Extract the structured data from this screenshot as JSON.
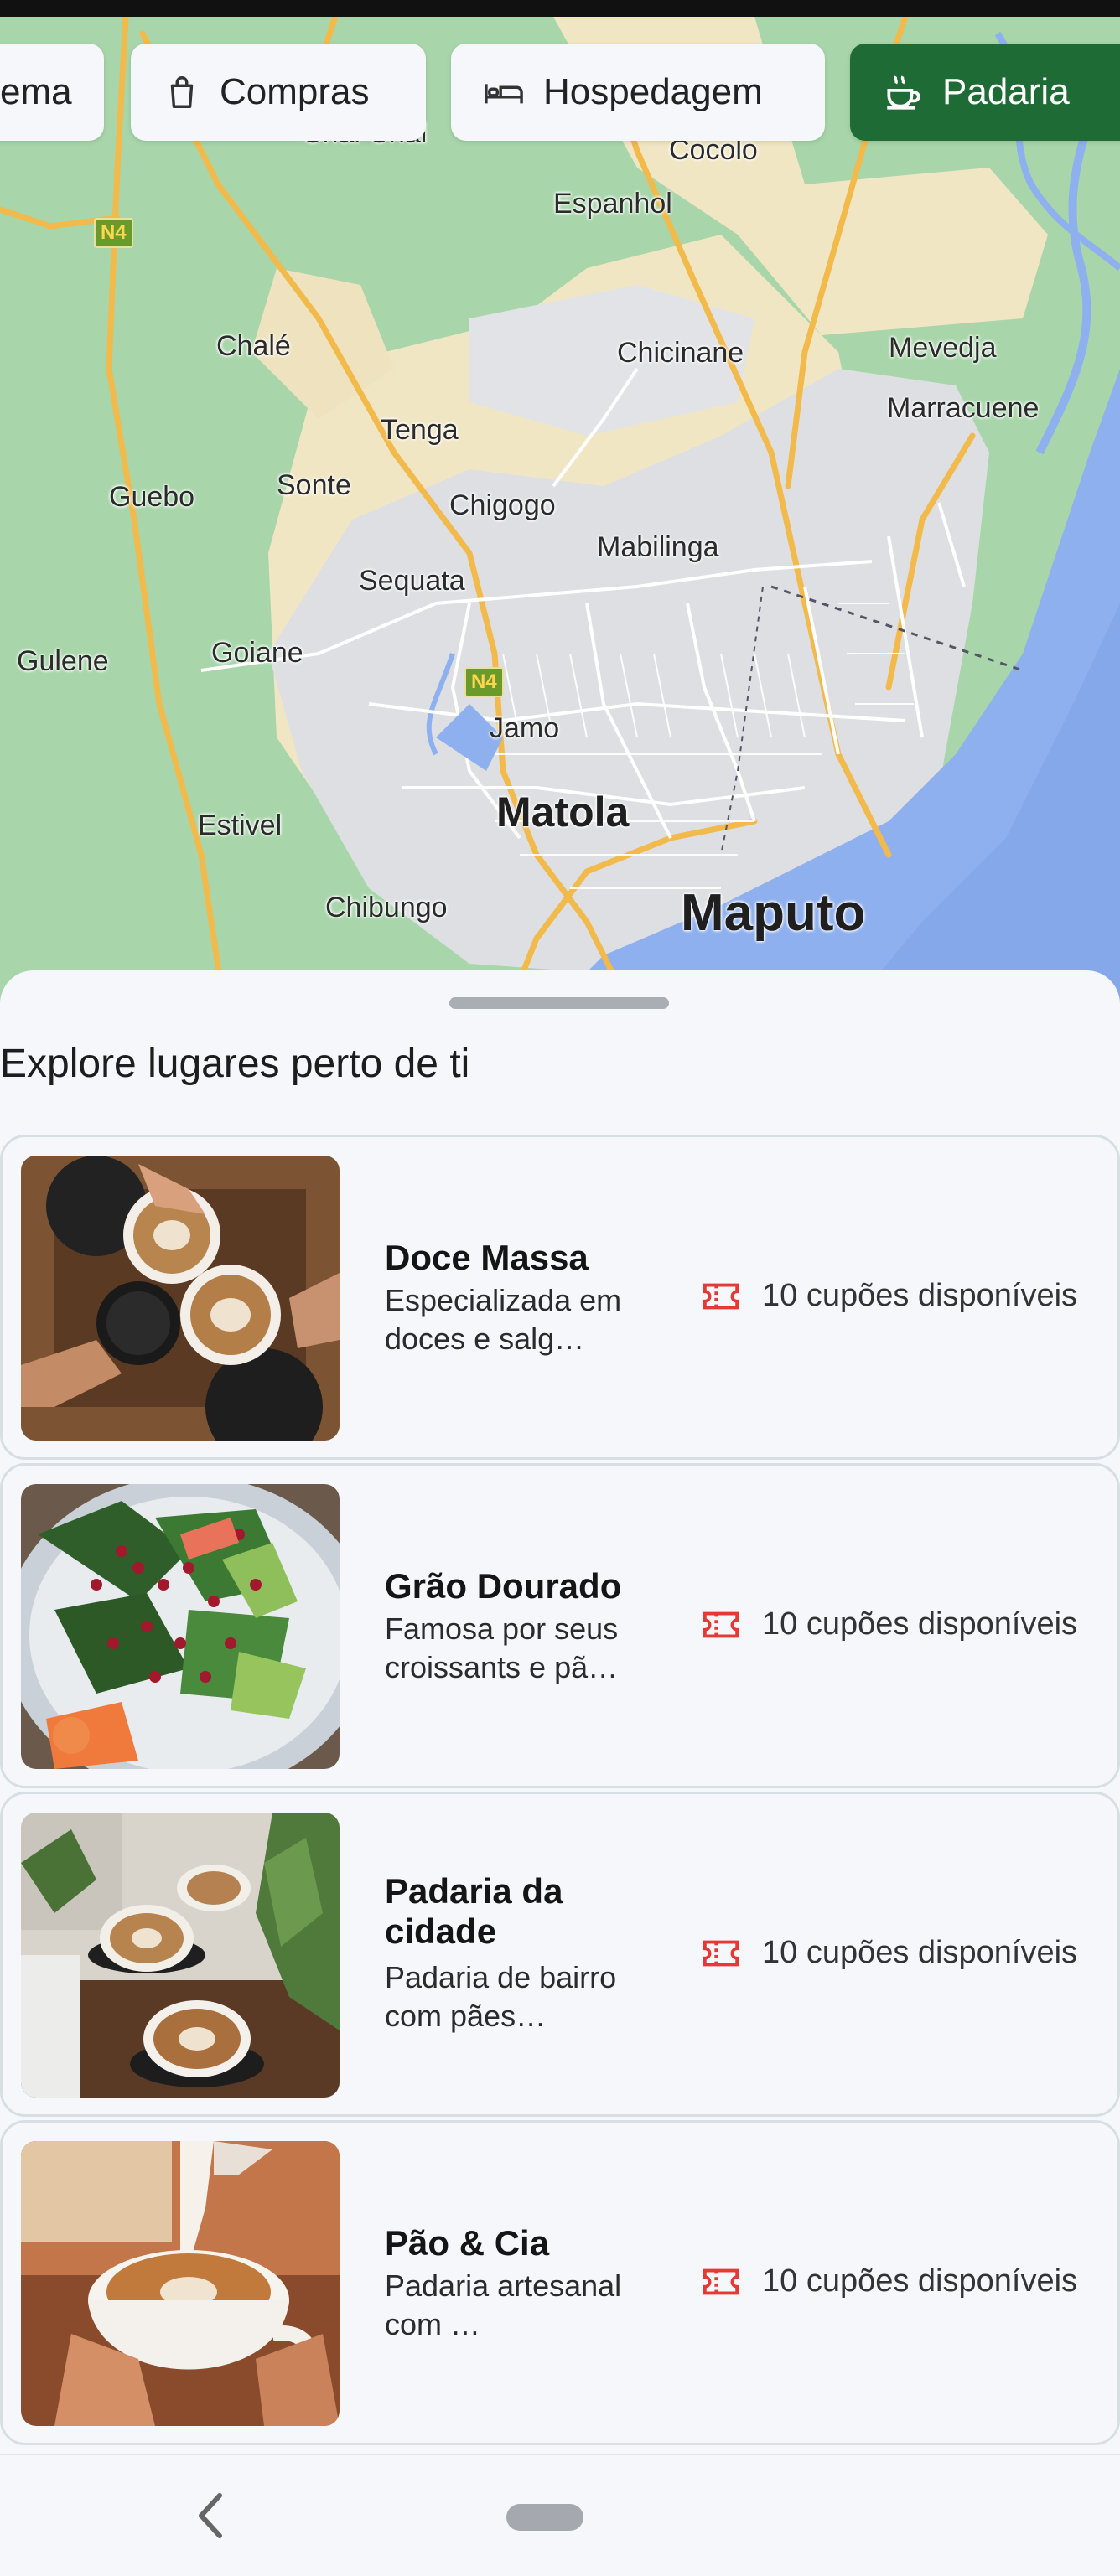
{
  "map": {
    "labels": [
      {
        "text": "Chal Chal"
      },
      {
        "text": "Cocolo"
      },
      {
        "text": "Espanhol"
      },
      {
        "text": "Chalé"
      },
      {
        "text": "Chicinane"
      },
      {
        "text": "Mevedja"
      },
      {
        "text": "Marracuene"
      },
      {
        "text": "Tenga"
      },
      {
        "text": "Guebo"
      },
      {
        "text": "Sonte"
      },
      {
        "text": "Chigogo"
      },
      {
        "text": "Mabilinga"
      },
      {
        "text": "Sequata"
      },
      {
        "text": "Gulene"
      },
      {
        "text": "Goiane"
      },
      {
        "text": "Jamo"
      },
      {
        "text": "Matola"
      },
      {
        "text": "Estivel"
      },
      {
        "text": "Chibungo"
      },
      {
        "text": "Maputo"
      }
    ],
    "shields": [
      "N4",
      "N4"
    ]
  },
  "categories": [
    {
      "label": "ema",
      "icon": "film-icon",
      "active": false
    },
    {
      "label": "Compras",
      "icon": "shopping-bag-icon",
      "active": false
    },
    {
      "label": "Hospedagem",
      "icon": "bed-icon",
      "active": false
    },
    {
      "label": "Padaria",
      "icon": "coffee-cup-icon",
      "active": true
    }
  ],
  "sheet": {
    "title": "Explore lugares perto de ti"
  },
  "places": [
    {
      "name": "Doce Massa",
      "description": "Especializada em doces e salg…",
      "coupons": "10 cupões disponíveis"
    },
    {
      "name": "Grão Dourado",
      "description": "Famosa por seus croissants e pã…",
      "coupons": "10 cupões disponíveis"
    },
    {
      "name": "Padaria da cidade",
      "description": "Padaria de bairro com pães…",
      "coupons": "10 cupões disponíveis"
    },
    {
      "name": "Pão & Cia",
      "description": "Padaria artesanal com …",
      "coupons": "10 cupões disponíveis"
    }
  ],
  "colors": {
    "accent": "#1f6b36",
    "coupon_icon": "#e53935",
    "sheet_bg": "#f6f7fb"
  }
}
